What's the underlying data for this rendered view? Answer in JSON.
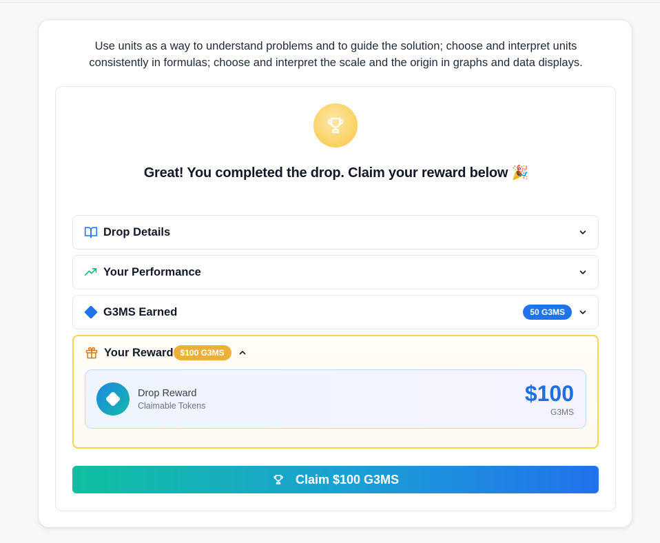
{
  "standard_text": "Use units as a way to understand problems and to guide the solution; choose and interpret units consistently in formulas; choose and interpret the scale and the origin in graphs and data displays.",
  "headline": "Great! You completed the drop. Claim your reward below 🎉",
  "sections": {
    "drop_details": {
      "label": "Drop Details",
      "icon": "book-open-icon"
    },
    "performance": {
      "label": "Your Performance",
      "icon": "trending-up-icon"
    },
    "g3ms_earned": {
      "label": "G3MS Earned",
      "icon": "diamond-icon",
      "badge": "50 G3MS",
      "badge_color": "#2173ec"
    },
    "reward": {
      "label": "Your Reward",
      "icon": "gift-icon",
      "badge": "$100 G3MS",
      "badge_color": "#eab03a"
    }
  },
  "reward_card": {
    "title": "Drop Reward",
    "subtitle": "Claimable Tokens",
    "amount": "$100",
    "unit": "G3MS"
  },
  "claim_button": {
    "label": "Claim $100 G3MS",
    "icon": "trophy-icon"
  },
  "colors": {
    "accent_blue": "#1e6fe0",
    "accent_teal": "#0fbfa0",
    "reward_border": "#fcd34d"
  }
}
